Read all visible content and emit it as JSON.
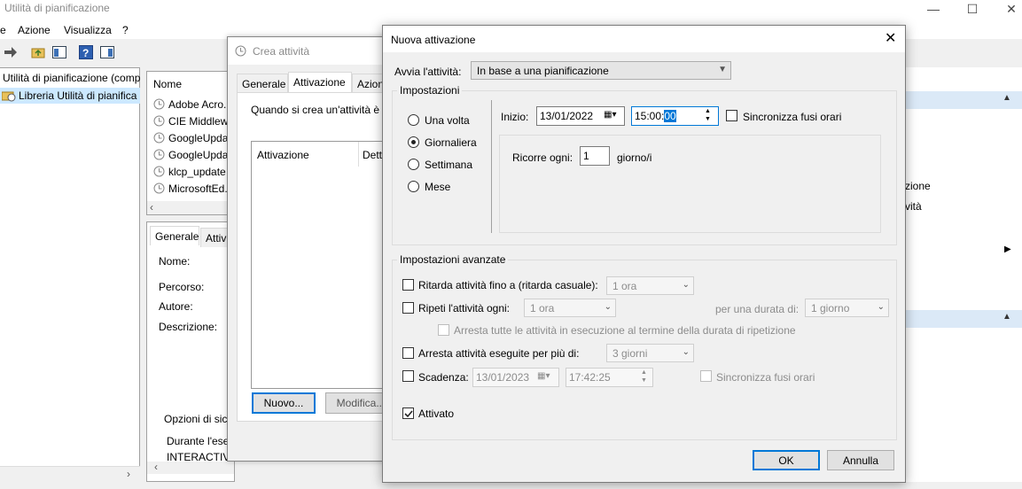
{
  "main": {
    "title": "Utilità di pianificazione",
    "menu": [
      "e",
      "Azione",
      "Visualizza",
      "?"
    ],
    "tree": [
      "Utilità di pianificazione (comp",
      "Libreria Utilità di pianifica"
    ],
    "list_header": "Nome",
    "tasks": [
      "Adobe Acro...",
      "CIE Middlew",
      "GoogleUpda",
      "GoogleUpda",
      "klcp_update",
      "MicrosoftEd..."
    ],
    "detail_tabs": [
      "Generale",
      "Attiv"
    ],
    "detail_labels": [
      "Nome:",
      "Percorso:",
      "Autore:",
      "Descrizione:"
    ],
    "options_label": "Opzioni di sic",
    "during_label": "Durante l'ese",
    "interactive_label": "INTERACTIVE",
    "right_items": [
      "zione",
      "vità"
    ]
  },
  "crea": {
    "title": "Crea attività",
    "tabs": [
      "Generale",
      "Attivazione",
      "Azion"
    ],
    "desc": "Quando si crea un'attività è p",
    "col_activation": "Attivazione",
    "col_details": "Dett",
    "new_button": "Nuovo...",
    "edit_button": "Modifica..."
  },
  "dialog": {
    "title": "Nuova attivazione",
    "start_label": "Avvia l'attività:",
    "start_value": "In base a una pianificazione",
    "settings_label": "Impostazioni",
    "radios": [
      {
        "label": "Una volta",
        "checked": false
      },
      {
        "label": "Giornaliera",
        "checked": true
      },
      {
        "label": "Settimana",
        "checked": false
      },
      {
        "label": "Mese",
        "checked": false
      }
    ],
    "start_date_label": "Inizio:",
    "start_date": "13/01/2022",
    "start_time_pre": "15:00:",
    "start_time_sel": "00",
    "sync_tz_label": "Sincronizza fusi orari",
    "recur_label": "Ricorre ogni:",
    "recur_value": "1",
    "recur_unit": "giorno/i",
    "advanced_label": "Impostazioni avanzate",
    "delay_label": "Ritarda attività fino a (ritarda casuale):",
    "delay_value": "1 ora",
    "repeat_label": "Ripeti l'attività ogni:",
    "repeat_value": "1 ora",
    "duration_label": "per una durata di:",
    "duration_value": "1 giorno",
    "stop_all_label": "Arresta tutte le attività in esecuzione al termine della durata di ripetizione",
    "stop_longer_label": "Arresta attività eseguite per più di:",
    "stop_longer_value": "3 giorni",
    "expire_label": "Scadenza:",
    "expire_date": "13/01/2023",
    "expire_time": "17:42:25",
    "expire_sync_label": "Sincronizza fusi orari",
    "enabled_label": "Attivato",
    "enabled": true,
    "ok_label": "OK",
    "cancel_label": "Annulla"
  }
}
